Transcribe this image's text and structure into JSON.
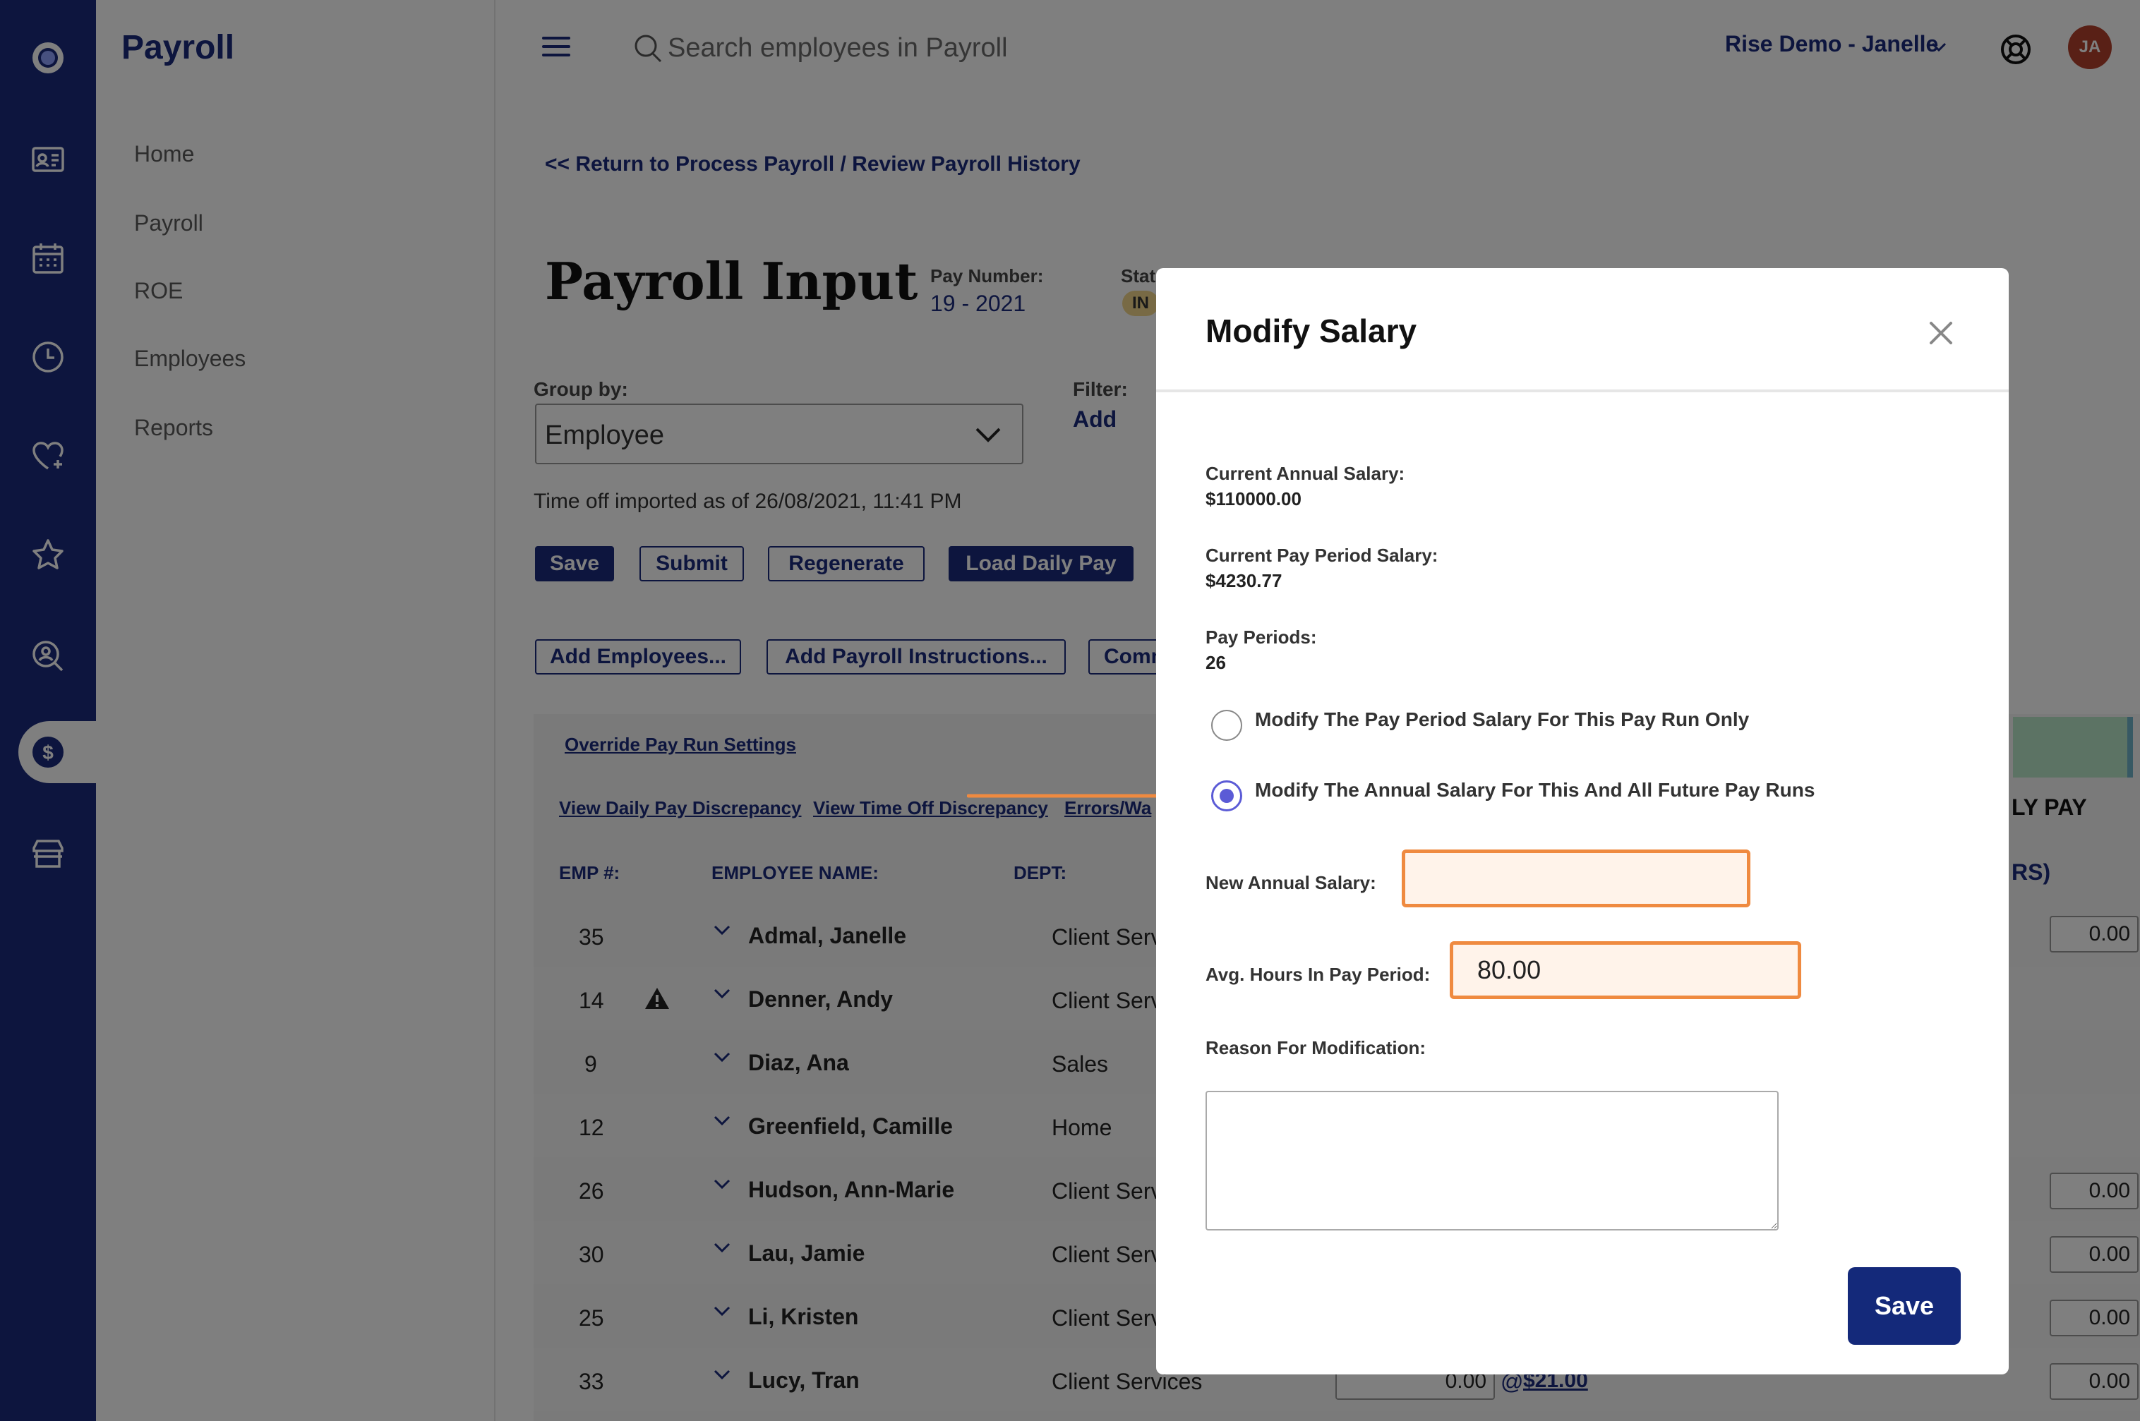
{
  "nav": {
    "title": "Payroll",
    "items": [
      {
        "label": "Home"
      },
      {
        "label": "Payroll"
      },
      {
        "label": "ROE"
      },
      {
        "label": "Employees"
      },
      {
        "label": "Reports"
      }
    ]
  },
  "header": {
    "search_placeholder": "Search employees in Payroll",
    "account": "Rise Demo - Janelle",
    "avatar_initials": "JA"
  },
  "page": {
    "back_link": "<< Return to Process Payroll / Review Payroll History",
    "title": "Payroll Input",
    "pay_number_label": "Pay Number:",
    "pay_number": "19 - 2021",
    "status_label": "Stat",
    "status_badge": "IN",
    "group_by_label": "Group by:",
    "group_by_value": "Employee",
    "filter_label": "Filter:",
    "filter_add": "Add",
    "time_off_note": "Time off imported as of 26/08/2021, 11:41 PM",
    "buttons": {
      "save": "Save",
      "submit": "Submit",
      "regenerate": "Regenerate",
      "load_daily_pay": "Load Daily Pay",
      "add_employees": "Add Employees...",
      "add_payroll_instructions": "Add Payroll Instructions...",
      "comm": "Comm"
    },
    "links": {
      "override": "Override Pay Run Settings",
      "daily_discrepancy": "View Daily Pay Discrepancy",
      "timeoff_discrepancy": "View Time Off Discrepancy",
      "errors": "Errors/Wa"
    },
    "columns": {
      "emp": "EMP #:",
      "name": "EMPLOYEE NAME:",
      "dept": "DEPT:",
      "right_head": "LY PAY",
      "right_head2": "RS)"
    },
    "rows": [
      {
        "emp": "35",
        "name": "Admal, Janelle",
        "dept": "Client Services",
        "pay": "0.00"
      },
      {
        "emp": "14",
        "name": "Denner, Andy",
        "dept": "Client Services",
        "pay": ""
      },
      {
        "emp": "9",
        "name": "Diaz, Ana",
        "dept": "Sales",
        "pay": ""
      },
      {
        "emp": "12",
        "name": "Greenfield, Camille",
        "dept": "Home",
        "pay": ""
      },
      {
        "emp": "26",
        "name": "Hudson, Ann-Marie",
        "dept": "Client Services",
        "pay": "0.00"
      },
      {
        "emp": "30",
        "name": "Lau, Jamie",
        "dept": "Client Services",
        "pay": "0.00"
      },
      {
        "emp": "25",
        "name": "Li, Kristen",
        "dept": "Client Services",
        "pay": "0.00"
      },
      {
        "emp": "33",
        "name": "Lucy, Tran",
        "dept": "Client Services",
        "pay": "0.00",
        "hours": "0.00",
        "rate": "$21.00",
        "rate_prefix": "@"
      }
    ]
  },
  "modal": {
    "title": "Modify Salary",
    "current_annual_label": "Current Annual Salary:",
    "current_annual_value": "$110000.00",
    "current_period_label": "Current Pay Period Salary:",
    "current_period_value": "$4230.77",
    "pay_periods_label": "Pay Periods:",
    "pay_periods_value": "26",
    "option_this_run": "Modify The Pay Period Salary For This Pay Run Only",
    "option_future": "Modify The Annual Salary For This And All Future Pay Runs",
    "new_annual_label": "New Annual Salary:",
    "new_annual_value": "",
    "avg_hours_label": "Avg. Hours In Pay Period:",
    "avg_hours_value": "80.00",
    "reason_label": "Reason For Modification:",
    "reason_value": "",
    "save": "Save"
  },
  "colors": {
    "brand": "#1a2a7c",
    "highlight": "#ef8a40",
    "radio_selected": "#5b5bd6"
  }
}
